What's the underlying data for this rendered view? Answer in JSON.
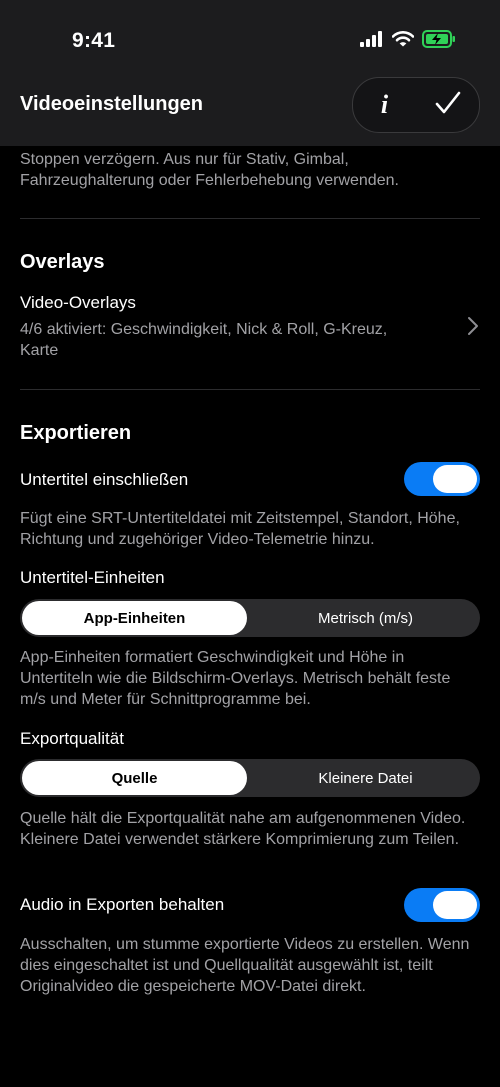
{
  "status_bar": {
    "time": "9:41"
  },
  "nav": {
    "title": "Videoeinstellungen",
    "info_label": "i"
  },
  "top_description": "Stoppen verzögern. Aus nur für Stativ, Gimbal, Fahrzeughalterung oder Fehlerbehebung verwenden.",
  "overlays": {
    "section_title": "Overlays",
    "row_title": "Video-Overlays",
    "row_subtitle": "4/6 aktiviert: Geschwindigkeit, Nick & Roll, G-Kreuz, Karte"
  },
  "export": {
    "section_title": "Exportieren",
    "subtitles_toggle": {
      "label": "Untertitel einschließen",
      "on": true
    },
    "subtitles_desc": "Fügt eine SRT-Untertiteldatei mit Zeitstempel, Standort, Höhe, Richtung und zugehöriger Video-Telemetrie hinzu.",
    "subtitle_units": {
      "label": "Untertitel-Einheiten",
      "options": [
        "App-Einheiten",
        "Metrisch (m/s)"
      ],
      "selected": "App-Einheiten",
      "desc": "App-Einheiten formatiert Geschwindigkeit und Höhe in Untertiteln wie die Bildschirm-Overlays. Metrisch behält feste m/s und Meter für Schnittprogramme bei."
    },
    "quality": {
      "label": "Exportqualität",
      "options": [
        "Quelle",
        "Kleinere Datei"
      ],
      "selected": "Quelle",
      "desc": "Quelle hält die Exportqualität nahe am aufgenommenen Video. Kleinere Datei verwendet stärkere Komprimierung zum Teilen."
    },
    "audio_toggle": {
      "label": "Audio in Exporten behalten",
      "on": true
    },
    "audio_desc": "Ausschalten, um stumme exportierte Videos zu erstellen. Wenn dies eingeschaltet ist und Quellqualität ausgewählt ist, teilt Originalvideo die gespeicherte MOV-Datei direkt."
  },
  "colors": {
    "accent": "#0a7cf5",
    "background": "#000000",
    "secondary_text": "#a2a2a6",
    "battery": "#30d158"
  }
}
